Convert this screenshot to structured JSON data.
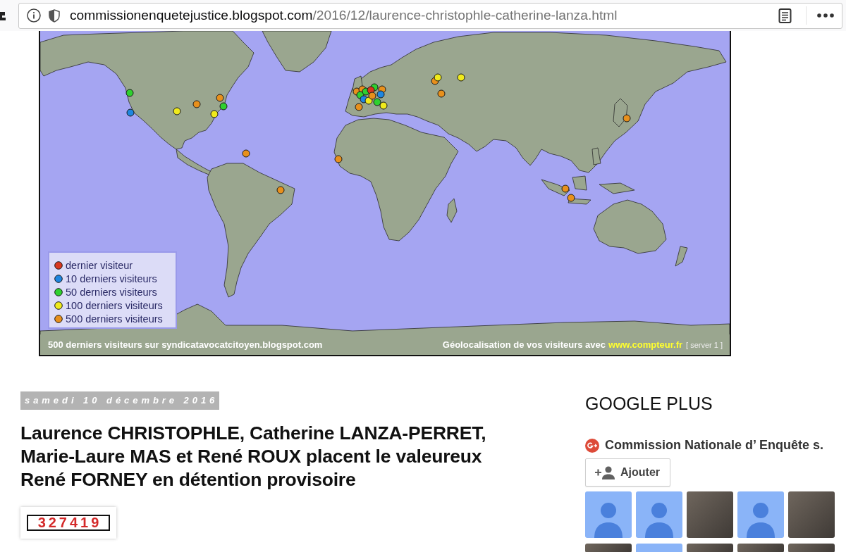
{
  "browser": {
    "url_host": "commissionenquetejustice.blogspot.com",
    "url_path": "/2016/12/laurence-christophle-catherine-lanza.html"
  },
  "map": {
    "markers": [
      {
        "color": "#2fd02f"
      },
      {
        "color": "#1f86e0"
      },
      {
        "color": "#f0ea1c"
      },
      {
        "color": "#e8901c"
      },
      {
        "color": "#e8901c"
      },
      {
        "color": "#2fd02f"
      },
      {
        "color": "#f0ea1c"
      },
      {
        "color": "#e8901c"
      },
      {
        "color": "#e8901c"
      },
      {
        "color": "#e8901c"
      },
      {
        "color": "#e8901c"
      },
      {
        "color": "#e8901c"
      },
      {
        "color": "#2fd02f"
      },
      {
        "color": "#2fd02f"
      },
      {
        "color": "#2fd02f"
      },
      {
        "color": "#e8901c"
      },
      {
        "color": "#1f86e0"
      },
      {
        "color": "#d9381e"
      },
      {
        "color": "#1f86e0"
      },
      {
        "color": "#f0ea1c"
      },
      {
        "color": "#e8901c"
      },
      {
        "color": "#2fd02f"
      },
      {
        "color": "#f0ea1c"
      },
      {
        "color": "#e8901c"
      },
      {
        "color": "#e8901c"
      },
      {
        "color": "#f0ea1c"
      },
      {
        "color": "#f0ea1c"
      },
      {
        "color": "#e8901c"
      },
      {
        "color": "#e8901c"
      },
      {
        "color": "#e8901c"
      },
      {
        "color": "#e8901c"
      }
    ],
    "legend": [
      {
        "label": "dernier visiteur",
        "color": "#d9381e"
      },
      {
        "label": "10 derniers visiteurs",
        "color": "#1f86e0"
      },
      {
        "label": "50 derniers visiteurs",
        "color": "#2fd02f"
      },
      {
        "label": "100 derniers visiteurs",
        "color": "#f0ea1c"
      },
      {
        "label": "500 derniers visiteurs",
        "color": "#e8901c"
      }
    ],
    "caption": "500 derniers visiteurs sur syndicatavocatcitoyen.blogspot.com",
    "credit": {
      "text": "Géolocalisation de vos visiteurs avec",
      "link": "www.compteur.fr",
      "server": "[ server 1 ]"
    }
  },
  "post": {
    "date": "samedi 10 décembre 2016",
    "title": "Laurence CHRISTOPHLE, Catherine LANZA-PERRET, Marie-Laure MAS et René ROUX placent le valeureux René FORNEY en détention provisoire",
    "counter": "327419"
  },
  "sidebar": {
    "heading": "GOOGLE PLUS",
    "widget": {
      "page_name": "Commission Nationale d’ Enquête s.",
      "follow_button": "Ajouter",
      "followers": [
        {
          "kind": "default"
        },
        {
          "kind": "default"
        },
        {
          "kind": "photo"
        },
        {
          "kind": "default"
        },
        {
          "kind": "photo"
        },
        {
          "kind": "photo"
        },
        {
          "kind": "default"
        },
        {
          "kind": "photo"
        },
        {
          "kind": "photo"
        },
        {
          "kind": "photo"
        }
      ]
    }
  }
}
